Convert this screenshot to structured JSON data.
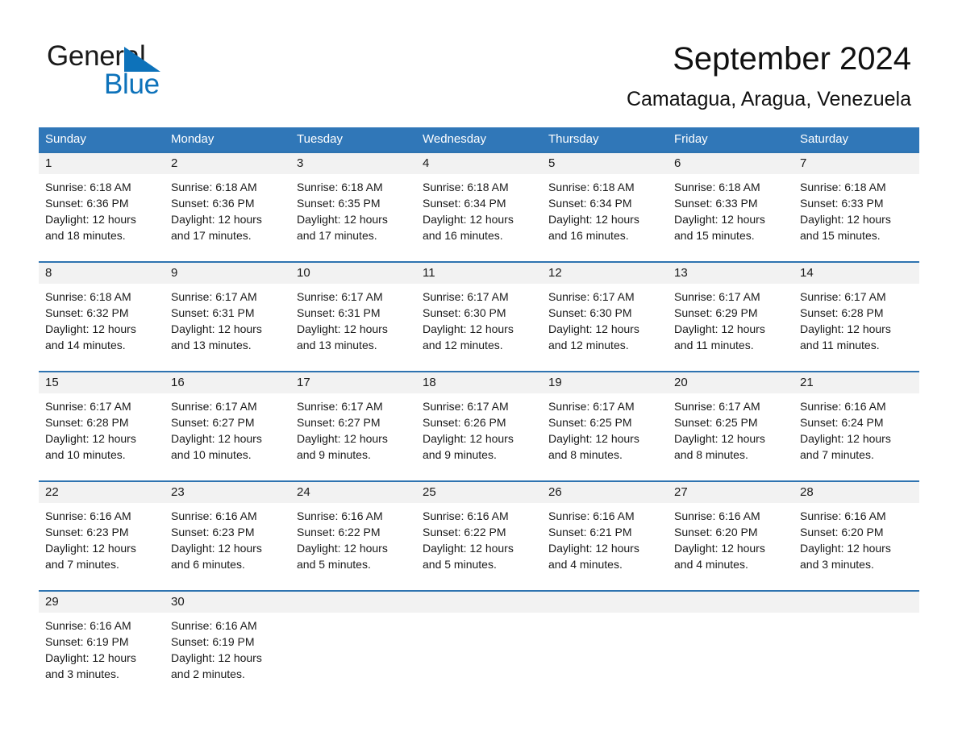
{
  "brand": {
    "word1": "General",
    "word2": "Blue",
    "triangle_color": "#0d72ba",
    "icon": "triangle-logo-icon"
  },
  "header": {
    "month_title": "September 2024",
    "location": "Camatagua, Aragua, Venezuela"
  },
  "colors": {
    "header_blue": "#3077b8",
    "row_divider_blue": "#2e73b0",
    "daynum_band": "#f2f2f2",
    "brand_blue": "#0d72ba"
  },
  "calendar": {
    "weekdays": [
      "Sunday",
      "Monday",
      "Tuesday",
      "Wednesday",
      "Thursday",
      "Friday",
      "Saturday"
    ],
    "weeks": [
      {
        "days": [
          {
            "num": "1",
            "sunrise": "Sunrise: 6:18 AM",
            "sunset": "Sunset: 6:36 PM",
            "daylight1": "Daylight: 12 hours",
            "daylight2": "and 18 minutes."
          },
          {
            "num": "2",
            "sunrise": "Sunrise: 6:18 AM",
            "sunset": "Sunset: 6:36 PM",
            "daylight1": "Daylight: 12 hours",
            "daylight2": "and 17 minutes."
          },
          {
            "num": "3",
            "sunrise": "Sunrise: 6:18 AM",
            "sunset": "Sunset: 6:35 PM",
            "daylight1": "Daylight: 12 hours",
            "daylight2": "and 17 minutes."
          },
          {
            "num": "4",
            "sunrise": "Sunrise: 6:18 AM",
            "sunset": "Sunset: 6:34 PM",
            "daylight1": "Daylight: 12 hours",
            "daylight2": "and 16 minutes."
          },
          {
            "num": "5",
            "sunrise": "Sunrise: 6:18 AM",
            "sunset": "Sunset: 6:34 PM",
            "daylight1": "Daylight: 12 hours",
            "daylight2": "and 16 minutes."
          },
          {
            "num": "6",
            "sunrise": "Sunrise: 6:18 AM",
            "sunset": "Sunset: 6:33 PM",
            "daylight1": "Daylight: 12 hours",
            "daylight2": "and 15 minutes."
          },
          {
            "num": "7",
            "sunrise": "Sunrise: 6:18 AM",
            "sunset": "Sunset: 6:33 PM",
            "daylight1": "Daylight: 12 hours",
            "daylight2": "and 15 minutes."
          }
        ]
      },
      {
        "days": [
          {
            "num": "8",
            "sunrise": "Sunrise: 6:18 AM",
            "sunset": "Sunset: 6:32 PM",
            "daylight1": "Daylight: 12 hours",
            "daylight2": "and 14 minutes."
          },
          {
            "num": "9",
            "sunrise": "Sunrise: 6:17 AM",
            "sunset": "Sunset: 6:31 PM",
            "daylight1": "Daylight: 12 hours",
            "daylight2": "and 13 minutes."
          },
          {
            "num": "10",
            "sunrise": "Sunrise: 6:17 AM",
            "sunset": "Sunset: 6:31 PM",
            "daylight1": "Daylight: 12 hours",
            "daylight2": "and 13 minutes."
          },
          {
            "num": "11",
            "sunrise": "Sunrise: 6:17 AM",
            "sunset": "Sunset: 6:30 PM",
            "daylight1": "Daylight: 12 hours",
            "daylight2": "and 12 minutes."
          },
          {
            "num": "12",
            "sunrise": "Sunrise: 6:17 AM",
            "sunset": "Sunset: 6:30 PM",
            "daylight1": "Daylight: 12 hours",
            "daylight2": "and 12 minutes."
          },
          {
            "num": "13",
            "sunrise": "Sunrise: 6:17 AM",
            "sunset": "Sunset: 6:29 PM",
            "daylight1": "Daylight: 12 hours",
            "daylight2": "and 11 minutes."
          },
          {
            "num": "14",
            "sunrise": "Sunrise: 6:17 AM",
            "sunset": "Sunset: 6:28 PM",
            "daylight1": "Daylight: 12 hours",
            "daylight2": "and 11 minutes."
          }
        ]
      },
      {
        "days": [
          {
            "num": "15",
            "sunrise": "Sunrise: 6:17 AM",
            "sunset": "Sunset: 6:28 PM",
            "daylight1": "Daylight: 12 hours",
            "daylight2": "and 10 minutes."
          },
          {
            "num": "16",
            "sunrise": "Sunrise: 6:17 AM",
            "sunset": "Sunset: 6:27 PM",
            "daylight1": "Daylight: 12 hours",
            "daylight2": "and 10 minutes."
          },
          {
            "num": "17",
            "sunrise": "Sunrise: 6:17 AM",
            "sunset": "Sunset: 6:27 PM",
            "daylight1": "Daylight: 12 hours",
            "daylight2": "and 9 minutes."
          },
          {
            "num": "18",
            "sunrise": "Sunrise: 6:17 AM",
            "sunset": "Sunset: 6:26 PM",
            "daylight1": "Daylight: 12 hours",
            "daylight2": "and 9 minutes."
          },
          {
            "num": "19",
            "sunrise": "Sunrise: 6:17 AM",
            "sunset": "Sunset: 6:25 PM",
            "daylight1": "Daylight: 12 hours",
            "daylight2": "and 8 minutes."
          },
          {
            "num": "20",
            "sunrise": "Sunrise: 6:17 AM",
            "sunset": "Sunset: 6:25 PM",
            "daylight1": "Daylight: 12 hours",
            "daylight2": "and 8 minutes."
          },
          {
            "num": "21",
            "sunrise": "Sunrise: 6:16 AM",
            "sunset": "Sunset: 6:24 PM",
            "daylight1": "Daylight: 12 hours",
            "daylight2": "and 7 minutes."
          }
        ]
      },
      {
        "days": [
          {
            "num": "22",
            "sunrise": "Sunrise: 6:16 AM",
            "sunset": "Sunset: 6:23 PM",
            "daylight1": "Daylight: 12 hours",
            "daylight2": "and 7 minutes."
          },
          {
            "num": "23",
            "sunrise": "Sunrise: 6:16 AM",
            "sunset": "Sunset: 6:23 PM",
            "daylight1": "Daylight: 12 hours",
            "daylight2": "and 6 minutes."
          },
          {
            "num": "24",
            "sunrise": "Sunrise: 6:16 AM",
            "sunset": "Sunset: 6:22 PM",
            "daylight1": "Daylight: 12 hours",
            "daylight2": "and 5 minutes."
          },
          {
            "num": "25",
            "sunrise": "Sunrise: 6:16 AM",
            "sunset": "Sunset: 6:22 PM",
            "daylight1": "Daylight: 12 hours",
            "daylight2": "and 5 minutes."
          },
          {
            "num": "26",
            "sunrise": "Sunrise: 6:16 AM",
            "sunset": "Sunset: 6:21 PM",
            "daylight1": "Daylight: 12 hours",
            "daylight2": "and 4 minutes."
          },
          {
            "num": "27",
            "sunrise": "Sunrise: 6:16 AM",
            "sunset": "Sunset: 6:20 PM",
            "daylight1": "Daylight: 12 hours",
            "daylight2": "and 4 minutes."
          },
          {
            "num": "28",
            "sunrise": "Sunrise: 6:16 AM",
            "sunset": "Sunset: 6:20 PM",
            "daylight1": "Daylight: 12 hours",
            "daylight2": "and 3 minutes."
          }
        ]
      },
      {
        "days": [
          {
            "num": "29",
            "sunrise": "Sunrise: 6:16 AM",
            "sunset": "Sunset: 6:19 PM",
            "daylight1": "Daylight: 12 hours",
            "daylight2": "and 3 minutes."
          },
          {
            "num": "30",
            "sunrise": "Sunrise: 6:16 AM",
            "sunset": "Sunset: 6:19 PM",
            "daylight1": "Daylight: 12 hours",
            "daylight2": "and 2 minutes."
          },
          {
            "num": "",
            "sunrise": "",
            "sunset": "",
            "daylight1": "",
            "daylight2": ""
          },
          {
            "num": "",
            "sunrise": "",
            "sunset": "",
            "daylight1": "",
            "daylight2": ""
          },
          {
            "num": "",
            "sunrise": "",
            "sunset": "",
            "daylight1": "",
            "daylight2": ""
          },
          {
            "num": "",
            "sunrise": "",
            "sunset": "",
            "daylight1": "",
            "daylight2": ""
          },
          {
            "num": "",
            "sunrise": "",
            "sunset": "",
            "daylight1": "",
            "daylight2": ""
          }
        ]
      }
    ]
  }
}
